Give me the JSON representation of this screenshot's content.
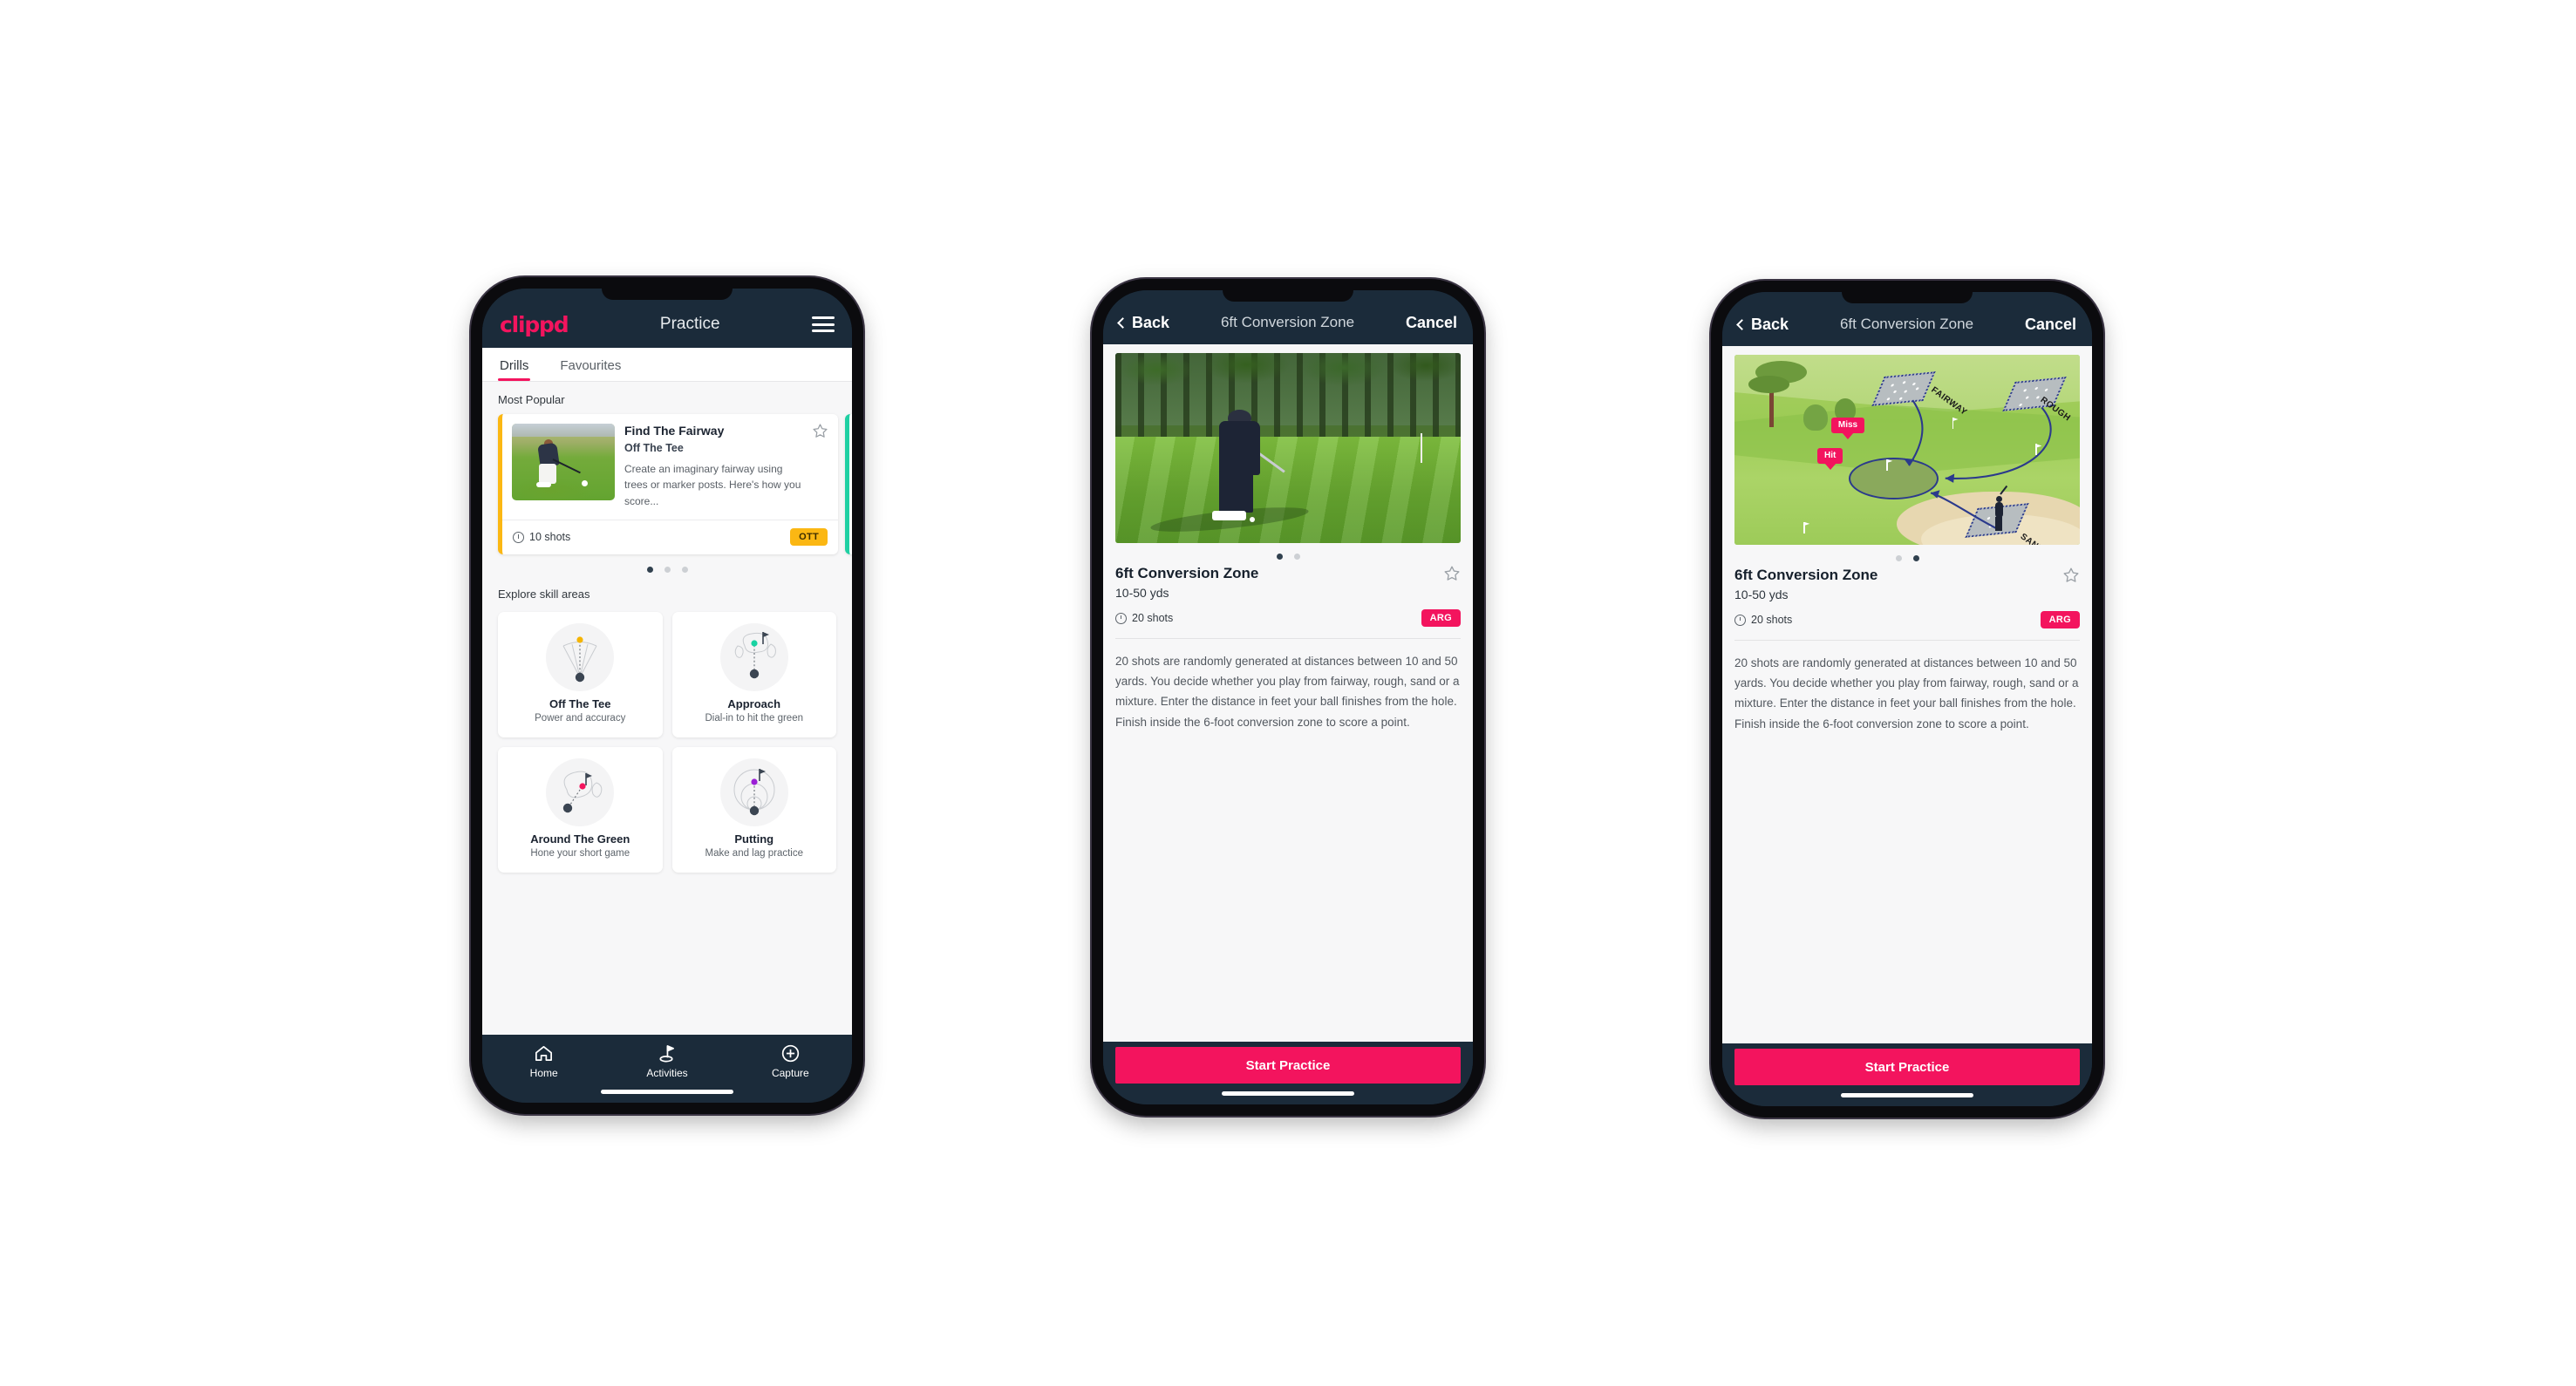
{
  "phone1": {
    "header": {
      "logo": "clippd",
      "title": "Practice",
      "menu_icon": "hamburger-icon"
    },
    "tabs": [
      {
        "label": "Drills",
        "active": true
      },
      {
        "label": "Favourites",
        "active": false
      }
    ],
    "sections": {
      "most_popular_label": "Most Popular",
      "explore_label": "Explore skill areas"
    },
    "featured_card": {
      "title": "Find The Fairway",
      "subtitle": "Off The Tee",
      "description": "Create an imaginary fairway using trees or marker posts. Here's how you score...",
      "shots": "10 shots",
      "badge": "OTT",
      "accent_color": "#fbb713",
      "next_card_accent": "#1fd0a3",
      "star_icon": "star-outline-icon",
      "clock_icon": "clock-icon"
    },
    "carousel_dots": {
      "count": 3,
      "active_index": 0
    },
    "skill_areas": [
      {
        "name": "Off The Tee",
        "desc": "Power and accuracy",
        "icon": "off-the-tee-icon",
        "dot_color": "#f5b400"
      },
      {
        "name": "Approach",
        "desc": "Dial-in to hit the green",
        "icon": "approach-icon",
        "dot_color": "#19d3a2"
      },
      {
        "name": "Around The Green",
        "desc": "Hone your short game",
        "icon": "around-the-green-icon",
        "dot_color": "#f3145e"
      },
      {
        "name": "Putting",
        "desc": "Make and lag practice",
        "icon": "putting-icon",
        "dot_color": "#9b1fd6"
      }
    ],
    "bottom_nav": [
      {
        "label": "Home",
        "icon": "home-icon",
        "active": false
      },
      {
        "label": "Activities",
        "icon": "golf-flag-icon",
        "active": true
      },
      {
        "label": "Capture",
        "icon": "plus-circle-icon",
        "active": false
      }
    ]
  },
  "phone2": {
    "nav": {
      "back": "Back",
      "title": "6ft Conversion Zone",
      "cancel": "Cancel",
      "back_icon": "chevron-left-icon"
    },
    "hero": {
      "type": "photo",
      "alt": "golfer-chipping-photo"
    },
    "carousel_dots": {
      "count": 2,
      "active_index": 0
    },
    "detail": {
      "title": "6ft Conversion Zone",
      "distance": "10-50 yds",
      "shots": "20 shots",
      "badge": "ARG",
      "badge_color": "#f3145e",
      "star_icon": "star-outline-icon",
      "clock_icon": "clock-icon",
      "description": "20 shots are randomly generated at distances between 10 and 50 yards. You decide whether you play from fairway, rough, sand or a mixture. Enter the distance in feet your ball finishes from the hole. Finish inside the 6-foot conversion zone to score a point."
    },
    "cta": "Start Practice"
  },
  "phone3": {
    "nav": {
      "back": "Back",
      "title": "6ft Conversion Zone",
      "cancel": "Cancel",
      "back_icon": "chevron-left-icon"
    },
    "hero": {
      "type": "diagram",
      "alt": "golf-course-diagram",
      "labels": {
        "fairway": "FAIRWAY",
        "rough": "ROUGH",
        "sand": "SAND"
      },
      "markers": {
        "miss": "Miss",
        "hit": "Hit"
      }
    },
    "carousel_dots": {
      "count": 2,
      "active_index": 1
    },
    "detail": {
      "title": "6ft Conversion Zone",
      "distance": "10-50 yds",
      "shots": "20 shots",
      "badge": "ARG",
      "badge_color": "#f3145e",
      "star_icon": "star-outline-icon",
      "clock_icon": "clock-icon",
      "description": "20 shots are randomly generated at distances between 10 and 50 yards. You decide whether you play from fairway, rough, sand or a mixture. Enter the distance in feet your ball finishes from the hole. Finish inside the 6-foot conversion zone to score a point."
    },
    "cta": "Start Practice"
  }
}
